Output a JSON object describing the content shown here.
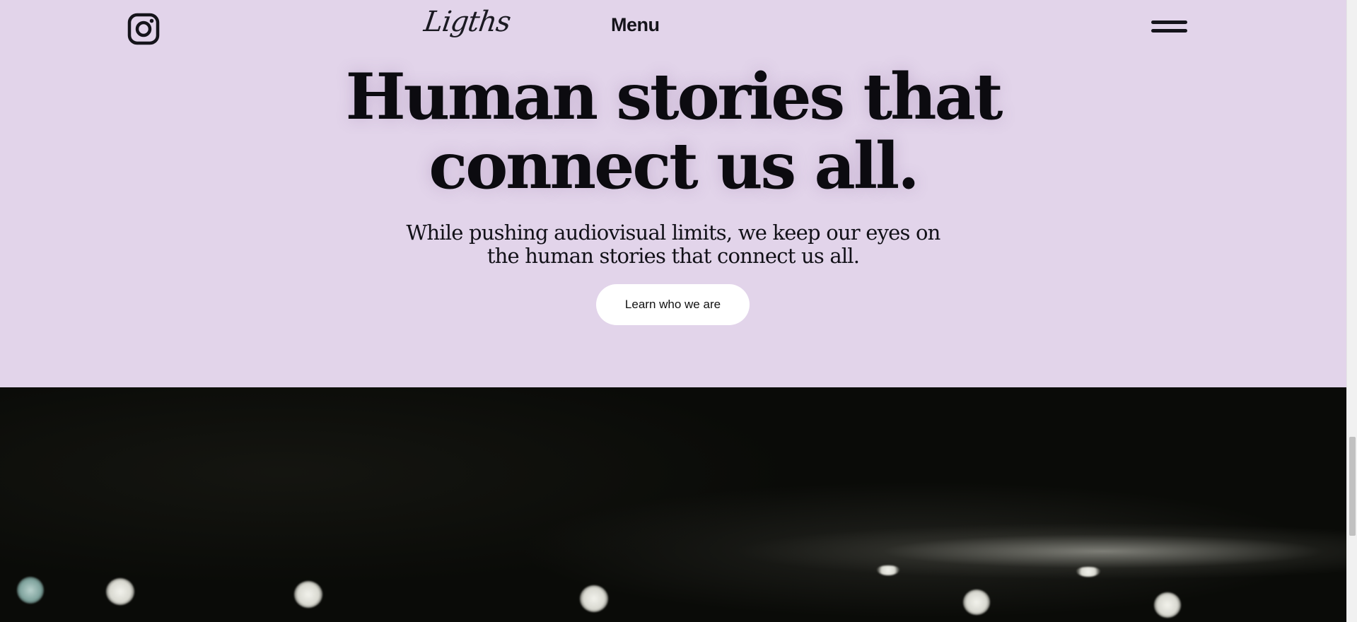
{
  "header": {
    "instagram_icon": "instagram-icon",
    "logo_text": "Ligths",
    "menu_label": "Menu",
    "menu_icon": "hamburger-icon"
  },
  "hero": {
    "headline_line1": "Human stories that",
    "headline_line2": "connect us all.",
    "subline_line1": "While pushing audiovisual limits, we keep our eyes on",
    "subline_line2": "the human stories that connect us all.",
    "cta_label": "Learn who we are"
  },
  "colors": {
    "hero_background": "#e2d4ea",
    "text": "#0c0b10",
    "button_background": "#ffffff",
    "video_background": "#0a0b08"
  }
}
